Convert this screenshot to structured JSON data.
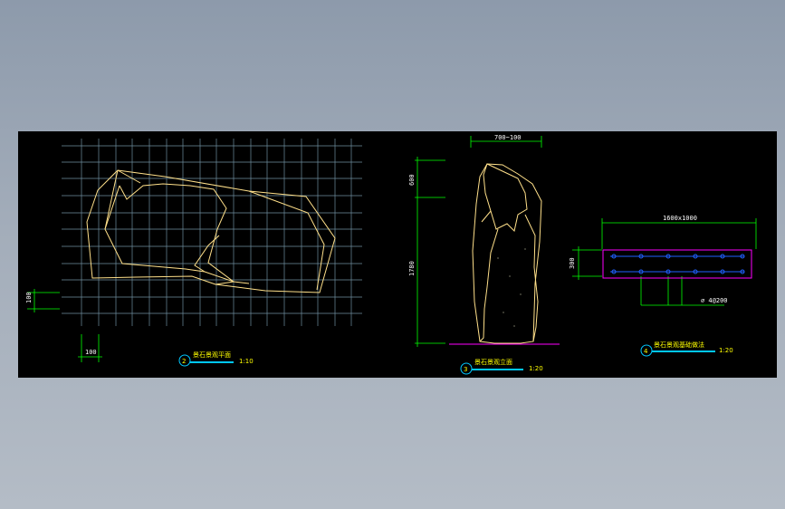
{
  "drawing": {
    "colors": {
      "background": "#000000",
      "grid": "#6f8fa0",
      "outline": "#ffe08a",
      "dimension": "#00ff00",
      "title": "#ffff00",
      "underline": "#00c8ff",
      "base_line": "#ff00ff"
    },
    "plan_view": {
      "title": "景石景观平面",
      "scale": "1:10",
      "index": "2",
      "dim_grid_v": "100",
      "dim_grid_h": "100"
    },
    "elevation_view": {
      "title": "景石景观立面",
      "scale": "1:20",
      "index": "3",
      "dim_top": "700~100",
      "dim_side_upper": "600",
      "dim_side_total": "1780"
    },
    "foundation_view": {
      "title": "景石景观基础做法",
      "scale": "1:20",
      "index": "4",
      "dim_width": "1600x1000",
      "dim_height": "300",
      "rebar_note": "∅ 4@200"
    }
  }
}
